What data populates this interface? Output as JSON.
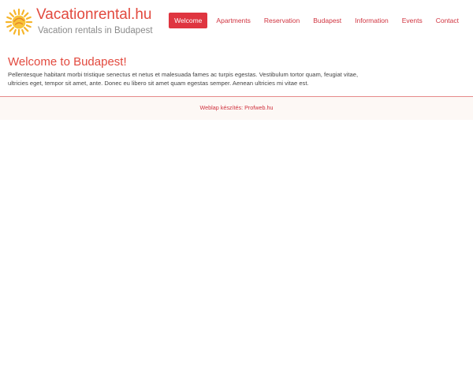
{
  "header": {
    "site_title": "Vacationrental.hu",
    "tagline": "Vacation rentals in Budapest",
    "logo_icon": "sun-icon"
  },
  "nav": {
    "items": [
      {
        "label": "Welcome",
        "active": true
      },
      {
        "label": "Apartments",
        "active": false
      },
      {
        "label": "Reservation",
        "active": false
      },
      {
        "label": "Budapest",
        "active": false
      },
      {
        "label": "Information",
        "active": false
      },
      {
        "label": "Events",
        "active": false
      },
      {
        "label": "Contact",
        "active": false
      }
    ]
  },
  "main": {
    "title": "Welcome to Budapest!",
    "body": "Pellentesque habitant morbi tristique senectus et netus et malesuada fames ac turpis egestas. Vestibulum tortor quam, feugiat vitae, ultricies eget, tempor sit amet, ante. Donec eu libero sit amet quam egestas semper. Aenean ultricies mi vitae est."
  },
  "footer": {
    "credit": "Weblap készítés: Profweb.hu"
  },
  "colors": {
    "accent": "#e24a3f",
    "nav_active_bg": "#df3540",
    "nav_text": "#d0333f",
    "tagline": "#8b8b8b",
    "footer_bg": "#fdf8f5"
  }
}
